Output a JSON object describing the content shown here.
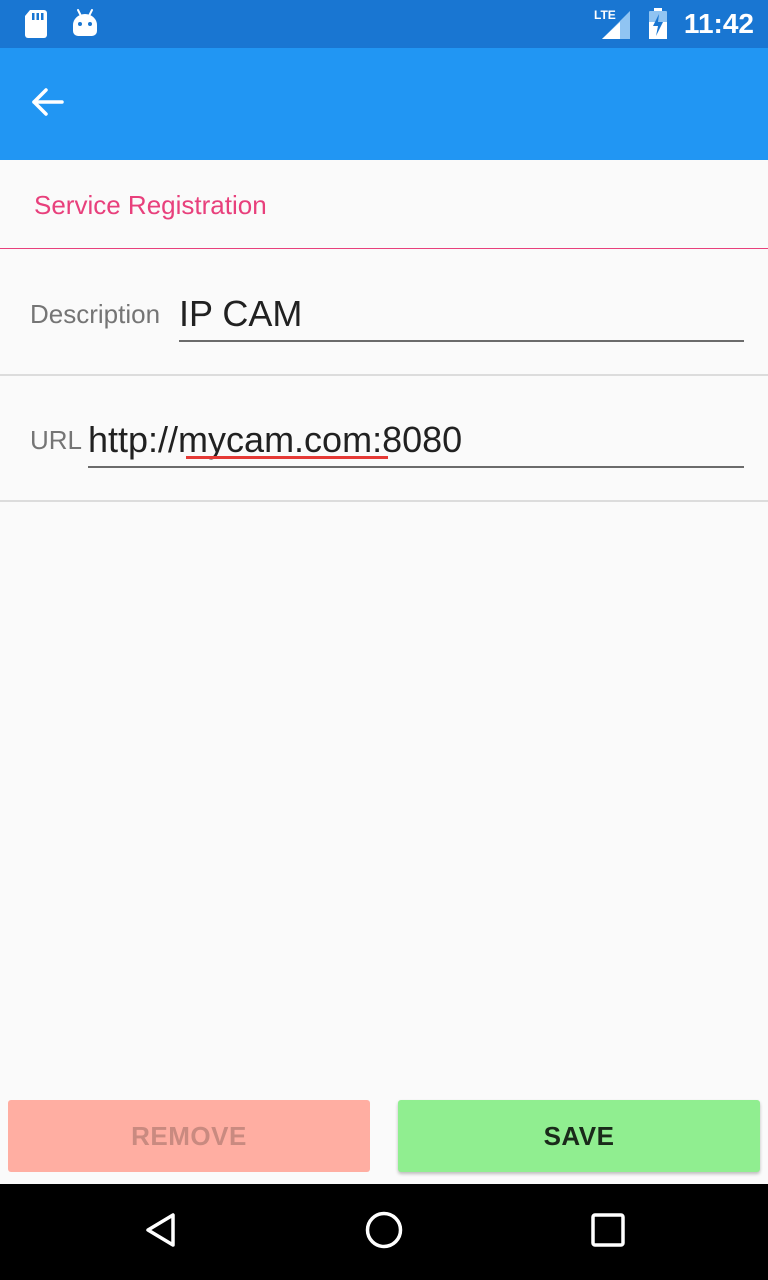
{
  "status_bar": {
    "time": "11:42",
    "icons": [
      "sd-card-icon",
      "android-icon",
      "lte-signal-icon",
      "battery-charging-icon"
    ]
  },
  "toolbar": {
    "back_icon": "arrow-left-icon"
  },
  "form": {
    "section_title": "Service Registration",
    "description": {
      "label": "Description",
      "value": "IP CAM"
    },
    "url": {
      "label": "URL",
      "value": "http://mycam.com:8080"
    }
  },
  "actions": {
    "remove_label": "REMOVE",
    "save_label": "SAVE"
  },
  "nav_bar": {
    "icons": [
      "back-triangle-icon",
      "home-circle-icon",
      "recents-square-icon"
    ]
  },
  "colors": {
    "status_bar": "#1976d2",
    "toolbar": "#2196f3",
    "accent": "#e8407c",
    "remove_button": "#ffaea2",
    "save_button": "#90ee90",
    "spell_error": "#e53935"
  }
}
